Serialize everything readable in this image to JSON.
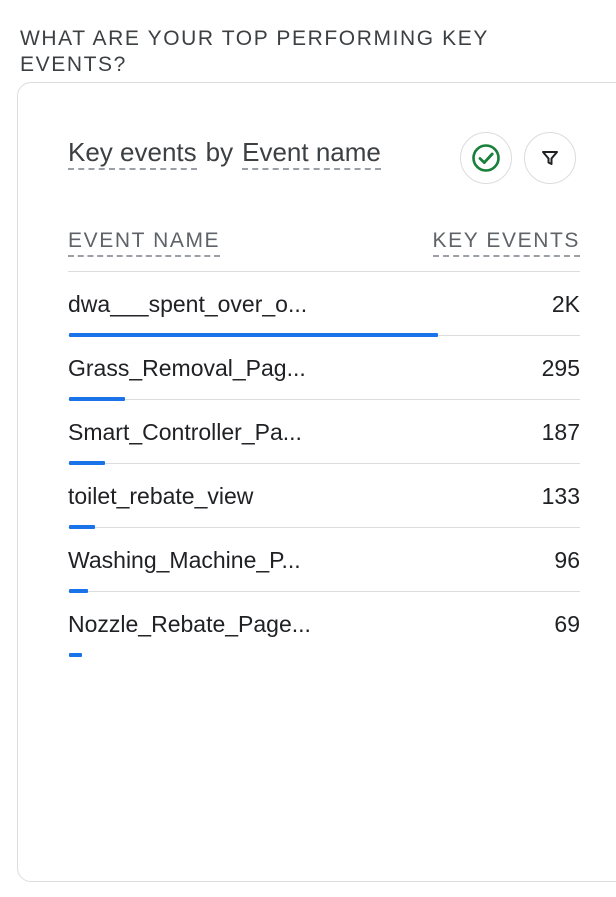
{
  "section": {
    "heading": "WHAT ARE YOUR TOP PERFORMING KEY EVENTS?"
  },
  "card": {
    "title_metric": "Key events",
    "title_by": "by",
    "title_dimension": "Event name",
    "columns": {
      "name": "EVENT NAME",
      "value": "KEY EVENTS"
    },
    "rows": [
      {
        "name": "dwa___spent_over_o...",
        "value": "2K",
        "bar_fraction": 0.72
      },
      {
        "name": "Grass_Removal_Pag...",
        "value": "295",
        "bar_fraction": 0.11
      },
      {
        "name": "Smart_Controller_Pa...",
        "value": "187",
        "bar_fraction": 0.07
      },
      {
        "name": "toilet_rebate_view",
        "value": "133",
        "bar_fraction": 0.05
      },
      {
        "name": "Washing_Machine_P...",
        "value": "96",
        "bar_fraction": 0.037
      },
      {
        "name": "Nozzle_Rebate_Page...",
        "value": "69",
        "bar_fraction": 0.025
      }
    ]
  },
  "icons": {
    "check": "check-circle-icon",
    "filter": "filter-icon"
  },
  "colors": {
    "accent": "#1a73e8",
    "check": "#188038",
    "text": "#202124",
    "muted": "#5f6368",
    "border": "#dadce0"
  }
}
